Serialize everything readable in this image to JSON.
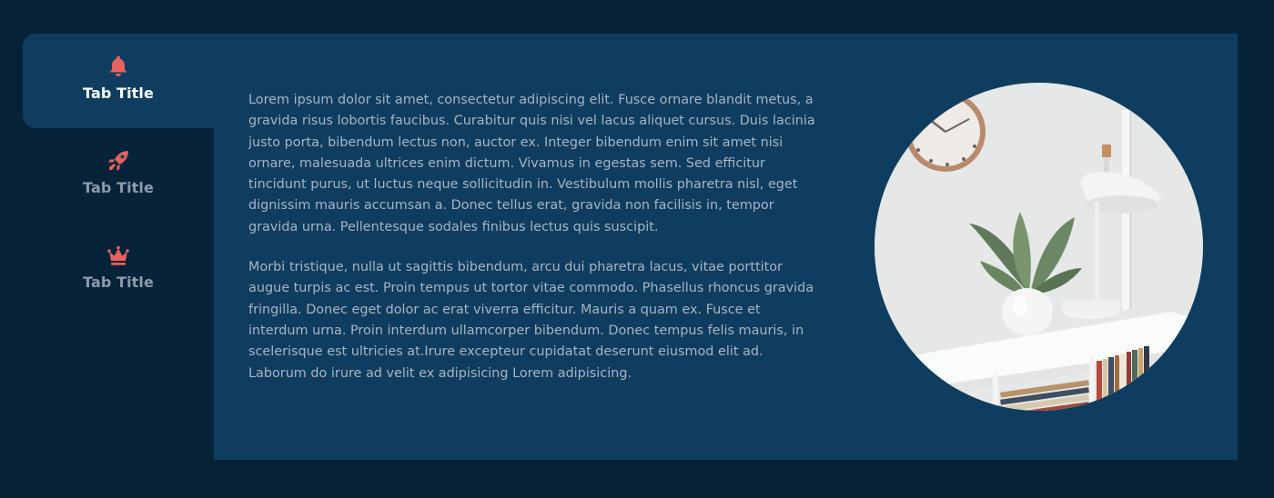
{
  "colors": {
    "page_background": "#06233a",
    "panel_background": "#0f3d5f",
    "accent": "#e8615c",
    "tab_inactive_text": "#8d9cab",
    "tab_active_text": "#ffffff",
    "body_text": "#a7b5c3"
  },
  "tabs": [
    {
      "label": "Tab Title",
      "icon": "bell-icon",
      "active": true
    },
    {
      "label": "Tab Title",
      "icon": "rocket-icon",
      "active": false
    },
    {
      "label": "Tab Title",
      "icon": "crown-icon",
      "active": false
    }
  ],
  "panel": {
    "paragraphs": [
      "Lorem ipsum dolor sit amet, consectetur adipiscing elit. Fusce ornare blandit metus, a gravida risus lobortis faucibus. Curabitur quis nisi vel lacus aliquet cursus. Duis lacinia justo porta, bibendum lectus non, auctor ex. Integer bibendum enim sit amet nisi ornare, malesuada ultrices enim dictum. Vivamus in egestas sem. Sed efficitur tincidunt purus, ut luctus neque sollicitudin in. Vestibulum mollis pharetra nisl, eget dignissim mauris accumsan a. Donec tellus erat, gravida non facilisis in, tempor gravida urna. Pellentesque sodales finibus lectus quis suscipit.",
      "Morbi tristique, nulla ut sagittis bibendum, arcu dui pharetra lacus, vitae porttitor augue turpis ac est. Proin tempus ut tortor vitae commodo. Phasellus rhoncus gravida fringilla. Donec eget dolor ac erat viverra efficitur. Mauris a quam ex. Fusce et interdum urna. Proin interdum ullamcorper bibendum. Donec tempus felis mauris, in scelerisque est ultricies at.Irure excepteur cupidatat deserunt eiusmod elit ad. Laborum do irure ad velit ex adipisicing Lorem adipisicing."
    ]
  }
}
